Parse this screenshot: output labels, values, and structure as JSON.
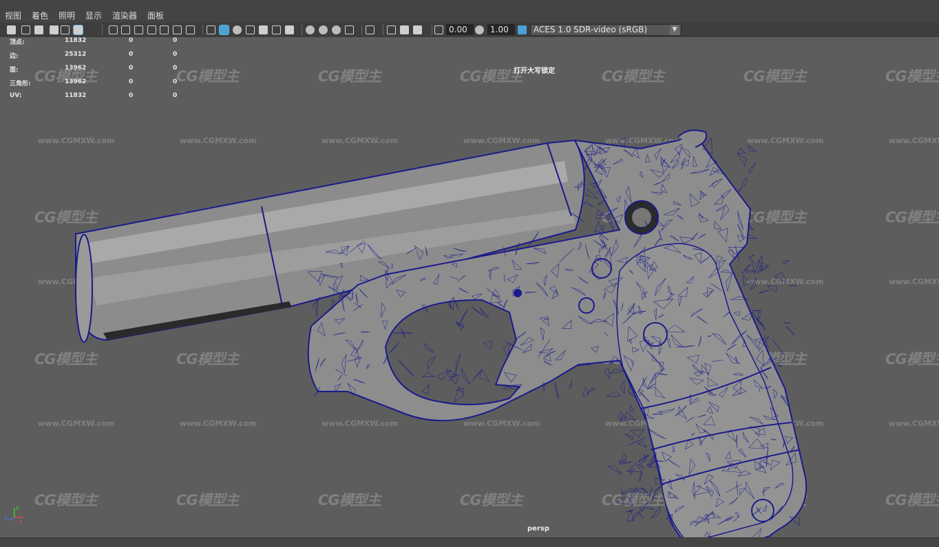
{
  "menu": [
    "视图",
    "着色",
    "照明",
    "显示",
    "渲染器",
    "面板"
  ],
  "toolbar": {
    "exposure_value": "0.00",
    "gamma_value": "1.00",
    "color_space": "ACES 1.0 SDR-video (sRGB)",
    "icons": [
      "camera-select-icon",
      "camera-attr-icon",
      "bookmark-icon",
      "image-plane-icon",
      "grease-pencil-icon",
      "2d-pan-zoom-icon",
      "grid-icon",
      "film-gate-icon",
      "resolution-gate-icon",
      "gate-mask-icon",
      "field-chart-icon",
      "safe-action-icon",
      "safe-title-icon",
      "wireframe-icon",
      "smooth-shade-icon",
      "default-material-icon",
      "wireframe-on-shaded-icon",
      "xray-icon",
      "texture-icon",
      "lighting-icon",
      "shadows-icon",
      "screen-ao-icon",
      "motion-blur-icon",
      "anti-alias-icon",
      "depth-of-field-icon",
      "isolate-select-icon",
      "xray-joints-icon",
      "xray-active-icon",
      "backface-icon",
      "exposure-icon",
      "gamma-icon",
      "color-mgmt-icon"
    ]
  },
  "hud": {
    "rows": [
      {
        "label": "顶点:",
        "a": "11832",
        "b": "0",
        "c": "0"
      },
      {
        "label": "边:",
        "a": "25312",
        "b": "0",
        "c": "0"
      },
      {
        "label": "面:",
        "a": "13962",
        "b": "0",
        "c": "0"
      },
      {
        "label": "三角形:",
        "a": "13962",
        "b": "0",
        "c": "0"
      },
      {
        "label": "UV:",
        "a": "11832",
        "b": "0",
        "c": "0"
      }
    ]
  },
  "viewport": {
    "caps_lock": "打开大写锁定",
    "camera": "persp",
    "axis_y": "y",
    "axis_x": "x",
    "axis_z": "z",
    "wire_color": "#1a1a8c",
    "shade_color": "#8a8a8a"
  },
  "watermark": {
    "logo": "CG模型主",
    "url": "www.CGMXW.com"
  }
}
